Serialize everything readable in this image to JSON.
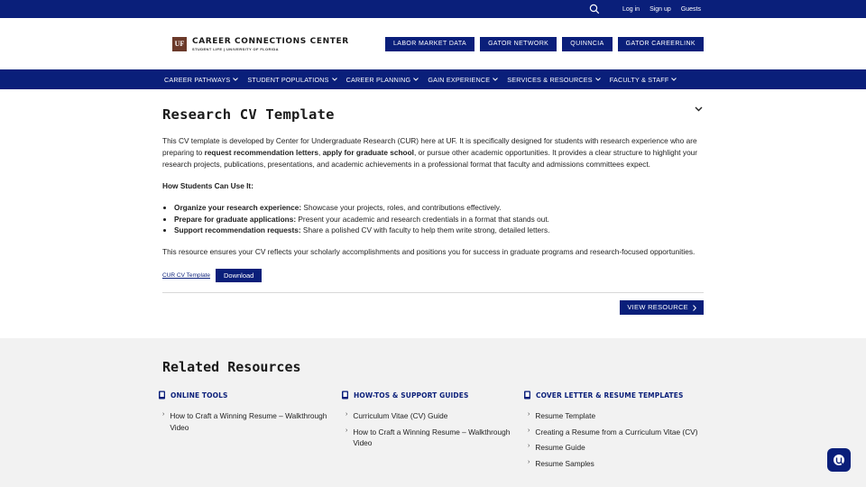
{
  "utility": {
    "login": "Log in",
    "signup": "Sign up",
    "guests": "Guests",
    "search_icon": "search-icon"
  },
  "brand": {
    "logo_mark": "UF",
    "title": "CAREER CONNECTIONS CENTER",
    "subtitle": "STUDENT LIFE | UNIVERSITY OF FLORIDA"
  },
  "quick_links": [
    "LABOR MARKET DATA",
    "GATOR NETWORK",
    "QUINNCIA",
    "GATOR CAREERLINK"
  ],
  "nav": [
    "CAREER PATHWAYS",
    "STUDENT POPULATIONS",
    "CAREER PLANNING",
    "GAIN EXPERIENCE",
    "SERVICES & RESOURCES",
    "FACULTY & STAFF"
  ],
  "page": {
    "title": "Research CV Template",
    "intro_1": "This CV template is developed by Center for Undergraduate Research (CUR) here at UF. It is specifically designed for students with research experience who are preparing to ",
    "intro_b1": "request recommendation letters",
    "intro_sep": ", ",
    "intro_b2": "apply for graduate school",
    "intro_2": ", or pursue other academic opportunities. It provides a clear structure to highlight your research projects, publications, presentations, and academic achievements in a professional format that faculty and admissions committees expect.",
    "subhead": "How Students Can Use It:",
    "bullets": [
      {
        "bold": "Organize your research experience:",
        "text": " Showcase your projects, roles, and contributions effectively."
      },
      {
        "bold": "Prepare for graduate applications:",
        "text": " Present your academic and research credentials in a format that stands out."
      },
      {
        "bold": "Support recommendation requests:",
        "text": " Share a polished CV with faculty to help them write strong, detailed letters."
      }
    ],
    "closing": "This resource ensures your CV reflects your scholarly accomplishments and positions you for success in graduate programs and research-focused opportunities.",
    "file_link": "CUR CV Template",
    "download": "Download",
    "view_resource": "VIEW RESOURCE"
  },
  "related": {
    "title": "Related Resources",
    "columns": [
      {
        "heading": "ONLINE TOOLS",
        "items": [
          "How to Craft a Winning Resume – Walkthrough Video"
        ]
      },
      {
        "heading": "HOW-TOS & SUPPORT GUIDES",
        "items": [
          "Curriculum Vitae (CV) Guide",
          "How to Craft a Winning Resume – Walkthrough Video"
        ]
      },
      {
        "heading": "COVER LETTER & RESUME TEMPLATES",
        "items": [
          "Resume Template",
          "Creating a Resume from a Curriculum Vitae (CV)",
          "Resume Guide",
          "Resume Samples"
        ]
      }
    ]
  },
  "colors": {
    "primary": "#0a1f7a",
    "logo": "#6b3a2a",
    "related_bg": "#f2f2f2"
  }
}
